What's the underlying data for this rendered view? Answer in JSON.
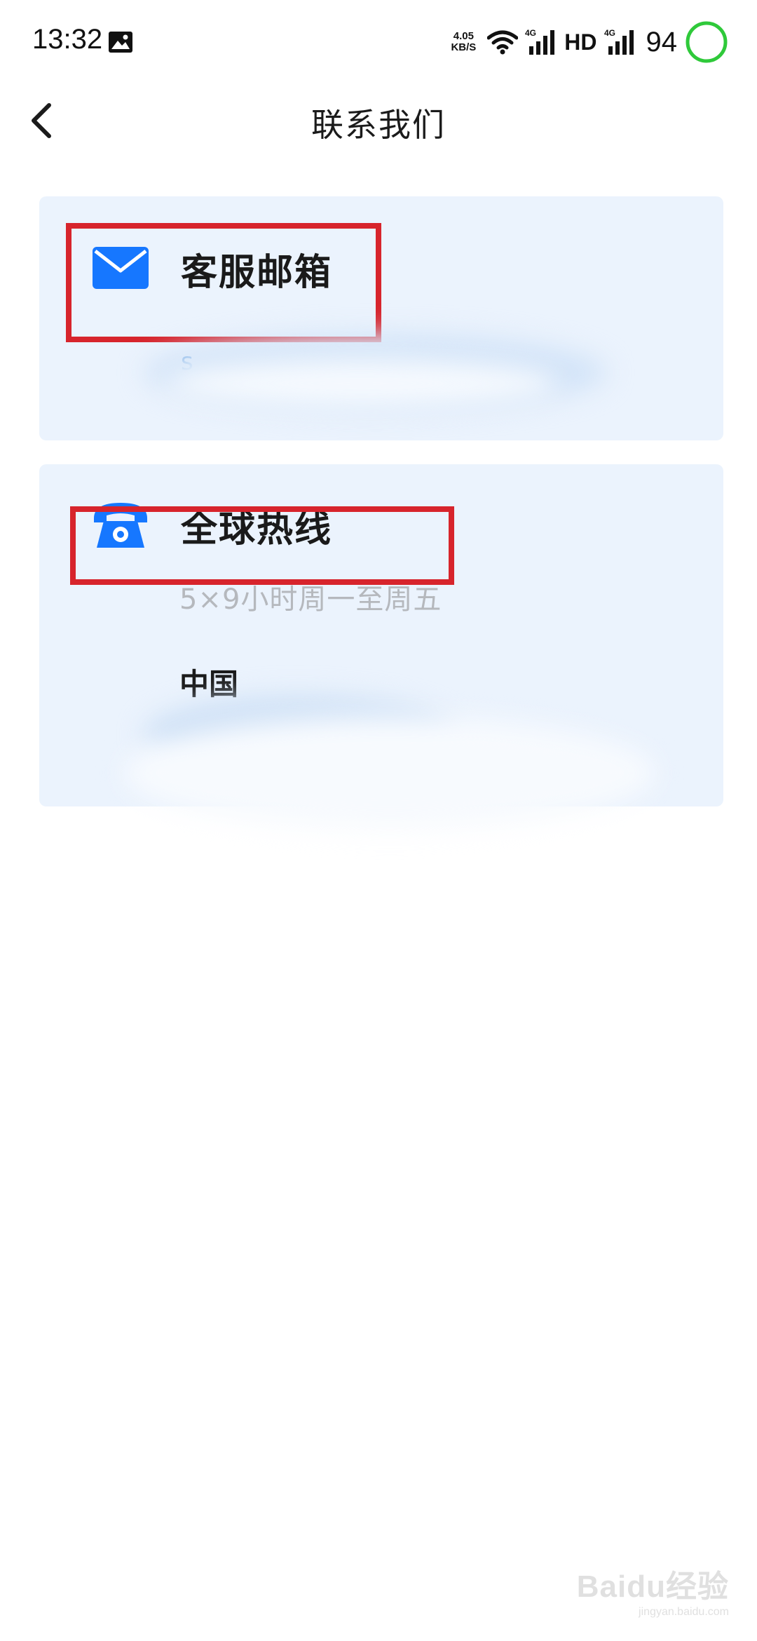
{
  "status_bar": {
    "time": "13:32",
    "network_speed_value": "4.05",
    "network_speed_unit": "KB/S",
    "signal_1_type": "4G",
    "hd_label": "HD",
    "signal_2_type": "4G",
    "battery_percent": "94",
    "battery_color": "#2fc93a",
    "icons": [
      "gallery-notification-icon",
      "wifi-icon",
      "cellular-signal-icon",
      "battery-ring-icon"
    ]
  },
  "header": {
    "back_icon": "chevron-left-icon",
    "title": "联系我们"
  },
  "cards": {
    "email": {
      "icon": "envelope-icon",
      "title": "客服邮箱",
      "value_visible_prefix": "s"
    },
    "hotline": {
      "icon": "telephone-icon",
      "title": "全球热线",
      "hours": "5×9小时周一至周五",
      "region": "中国"
    }
  },
  "watermark": {
    "main": "Baidu经验",
    "sub": "jingyan.baidu.com"
  },
  "colors": {
    "accent_blue": "#1677ff",
    "card_background": "#ebf3fd",
    "highlight_red": "#d7242c",
    "secondary_text": "#b5b8bd"
  }
}
